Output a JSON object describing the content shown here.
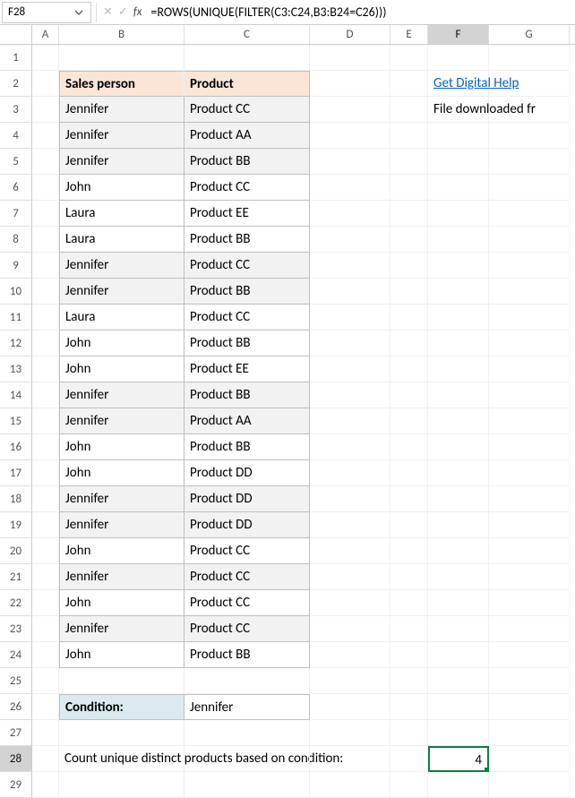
{
  "formula_bar": {
    "cell_ref": "F28",
    "fx_label": "fx",
    "formula": "=ROWS(UNIQUE(FILTER(C3:C24,B3:B24=C26)))"
  },
  "columns": [
    "A",
    "B",
    "C",
    "D",
    "E",
    "F",
    "G"
  ],
  "selected_column": "F",
  "selected_row": "28",
  "headers": {
    "B": "Sales person",
    "C": "Product"
  },
  "rows": [
    {
      "n": 3,
      "b": "Jennifer",
      "c": "Product CC",
      "shade": true
    },
    {
      "n": 4,
      "b": "Jennifer",
      "c": "Product AA",
      "shade": true
    },
    {
      "n": 5,
      "b": "Jennifer",
      "c": "Product BB",
      "shade": true
    },
    {
      "n": 6,
      "b": "John",
      "c": "Product CC",
      "shade": false
    },
    {
      "n": 7,
      "b": "Laura",
      "c": "Product EE",
      "shade": false
    },
    {
      "n": 8,
      "b": "Laura",
      "c": "Product BB",
      "shade": false
    },
    {
      "n": 9,
      "b": "Jennifer",
      "c": "Product CC",
      "shade": true
    },
    {
      "n": 10,
      "b": "Jennifer",
      "c": "Product BB",
      "shade": true
    },
    {
      "n": 11,
      "b": "Laura",
      "c": "Product CC",
      "shade": false
    },
    {
      "n": 12,
      "b": "John",
      "c": "Product BB",
      "shade": false
    },
    {
      "n": 13,
      "b": "John",
      "c": "Product EE",
      "shade": false
    },
    {
      "n": 14,
      "b": "Jennifer",
      "c": "Product BB",
      "shade": true
    },
    {
      "n": 15,
      "b": "Jennifer",
      "c": "Product AA",
      "shade": true
    },
    {
      "n": 16,
      "b": "John",
      "c": "Product BB",
      "shade": false
    },
    {
      "n": 17,
      "b": "John",
      "c": "Product DD",
      "shade": false
    },
    {
      "n": 18,
      "b": "Jennifer",
      "c": "Product DD",
      "shade": true
    },
    {
      "n": 19,
      "b": "Jennifer",
      "c": "Product DD",
      "shade": true
    },
    {
      "n": 20,
      "b": "John",
      "c": "Product CC",
      "shade": false
    },
    {
      "n": 21,
      "b": "Jennifer",
      "c": "Product CC",
      "shade": true
    },
    {
      "n": 22,
      "b": "John",
      "c": "Product CC",
      "shade": false
    },
    {
      "n": 23,
      "b": "Jennifer",
      "c": "Product CC",
      "shade": true
    },
    {
      "n": 24,
      "b": "John",
      "c": "Product BB",
      "shade": false
    }
  ],
  "condition": {
    "label": "Condition:",
    "value": "Jennifer"
  },
  "result_label": "Count unique distinct products based on condition:",
  "result_value": "4",
  "side": {
    "link": "Get Digital Help",
    "text": "File downloaded fr"
  }
}
